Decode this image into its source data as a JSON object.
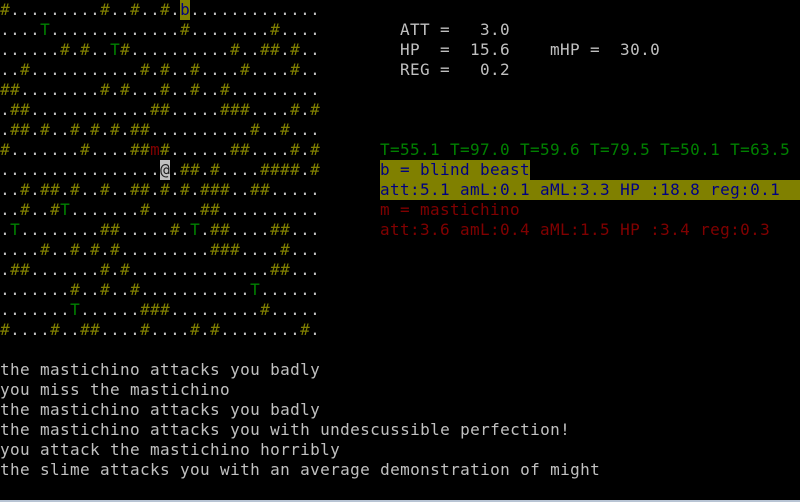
{
  "colors": {
    "wall": "#808000",
    "floor": "#c0c0c0",
    "tree": "#008000",
    "monster_m": "#800000",
    "monster_b_fg": "#000080",
    "monster_b_bg": "#808000",
    "player_bg": "#c0c0c0",
    "text": "#c0c0c0"
  },
  "map": {
    "rows": [
      "#.........#..#..#.b.............",
      "....T.............#........#....",
      "......#.#..T#..........#..##.#..",
      "..#...........#.#..#....#....#..",
      "##........#.#...#..#..#.........",
      ".##............##.....###....#.#",
      ".##.#..#.#.#.##..........#..#...",
      "#.......#....##m#......##....#.#",
      "................@.##.#....####.#",
      "..#.##.#..#..##.#.#.###..##.....",
      "..#..#T.......#.....##..........",
      ".T........##.....#.T.##....##...",
      "....#..#.#.#.........###....#...",
      ".##.......#.#..............##...",
      ".......#..#..#...........T......",
      ".......T......###.........#.....",
      "#....#..##....#....#.#........#."
    ],
    "legend": {
      "#": "wall",
      ".": "floor",
      "T": "tree",
      "@": "player",
      "b": "blind-beast",
      "m": "mastichino"
    }
  },
  "stats": {
    "att_line": "ATT =   3.0",
    "hp_line": "HP  =  15.6    mHP =  30.0",
    "reg_line": "REG =   0.2",
    "att": 3.0,
    "hp": 15.6,
    "max_hp": 30.0,
    "reg": 0.2
  },
  "info": {
    "temperatures": "T=55.1 T=97.0 T=59.6 T=79.5 T=50.1 T=63.5",
    "monsters": [
      {
        "title": "b = blind beast",
        "details": "att:5.1 amL:0.1 aML:3.3 HP :18.8 reg:0.1"
      },
      {
        "title": "m = mastichino",
        "details": "att:3.6 amL:0.4 aML:1.5 HP :3.4 reg:0.3"
      }
    ]
  },
  "messages": [
    "the mastichino attacks you badly",
    "you miss the mastichino",
    "the mastichino attacks you badly",
    "the mastichino attacks you with undescussible perfection!",
    "you attack the mastichino horribly",
    "the slime attacks you with an average demonstration of might"
  ]
}
